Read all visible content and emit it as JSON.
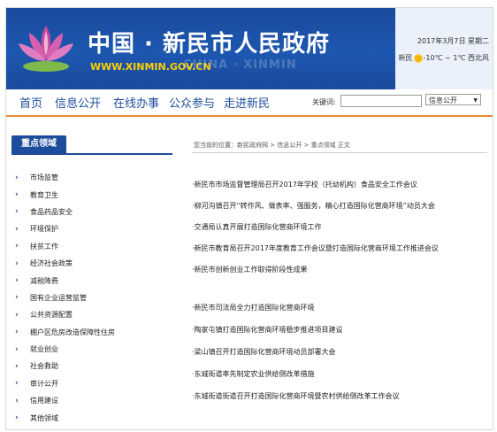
{
  "header": {
    "title": "中国 · 新民市人民政府",
    "url": "WWW.XINMIN.GOV.CN",
    "watermark": "CHINA · XINMIN",
    "date": "2017年3月7日 星期二",
    "weather_city": "新民",
    "weather_temp": "-10℃ ~ 1℃ 西北风",
    "logo_icon": "lotus-logo-icon"
  },
  "nav": {
    "items": [
      "首页",
      "信息公开",
      "在线办事",
      "公众参与",
      "走进新民"
    ],
    "keyword_label": "关键词:",
    "keyword_value": "",
    "select_value": "信息公开"
  },
  "sidebar": {
    "title": "重点领域",
    "items": [
      "市场监管",
      "教育卫生",
      "食品药品安全",
      "环境保护",
      "扶贫工作",
      "经济社会政策",
      "减税降费",
      "国有企业运营监管",
      "公共资源配置",
      "棚户区危房改造保障性住房",
      "就业创业",
      "社会救助",
      "审计公开",
      "信用建设",
      "其他领域"
    ]
  },
  "breadcrumb": "您当前的位置：新民政府网 > 信息公开 > 重点领域 正文",
  "news": [
    "·新民市市场监督管理局召开2017年学校（托幼机构）食品安全工作会议",
    "·柳河沟镇召开“转作风、做表率、强服务，精心打造国际化营商环境”动员大会",
    "·交通局认真开展打造国际化营商环境工作",
    "·新民市教育局召开2017年度教育工作会议暨打造国际化营商环境工作推进会议",
    "·新民市创新创业工作取得阶段性成果",
    "·新民市司法局全力打造国际化营商环境",
    "·陶家屯镇打造国际化营商环境稳步推进项目建设",
    "·梁山镇召开打造国际化营商环境动员部署大会",
    "·东城街道率先制定农业供给侧改革措施",
    "·东城街道街道召开打造国际化营商环境暨农村供给侧改革工作会议"
  ],
  "colors": {
    "banner": "#1d57b0",
    "nav_text": "#1d4c9c",
    "nav_border": "#e8893a",
    "url_text": "#ffd000"
  }
}
